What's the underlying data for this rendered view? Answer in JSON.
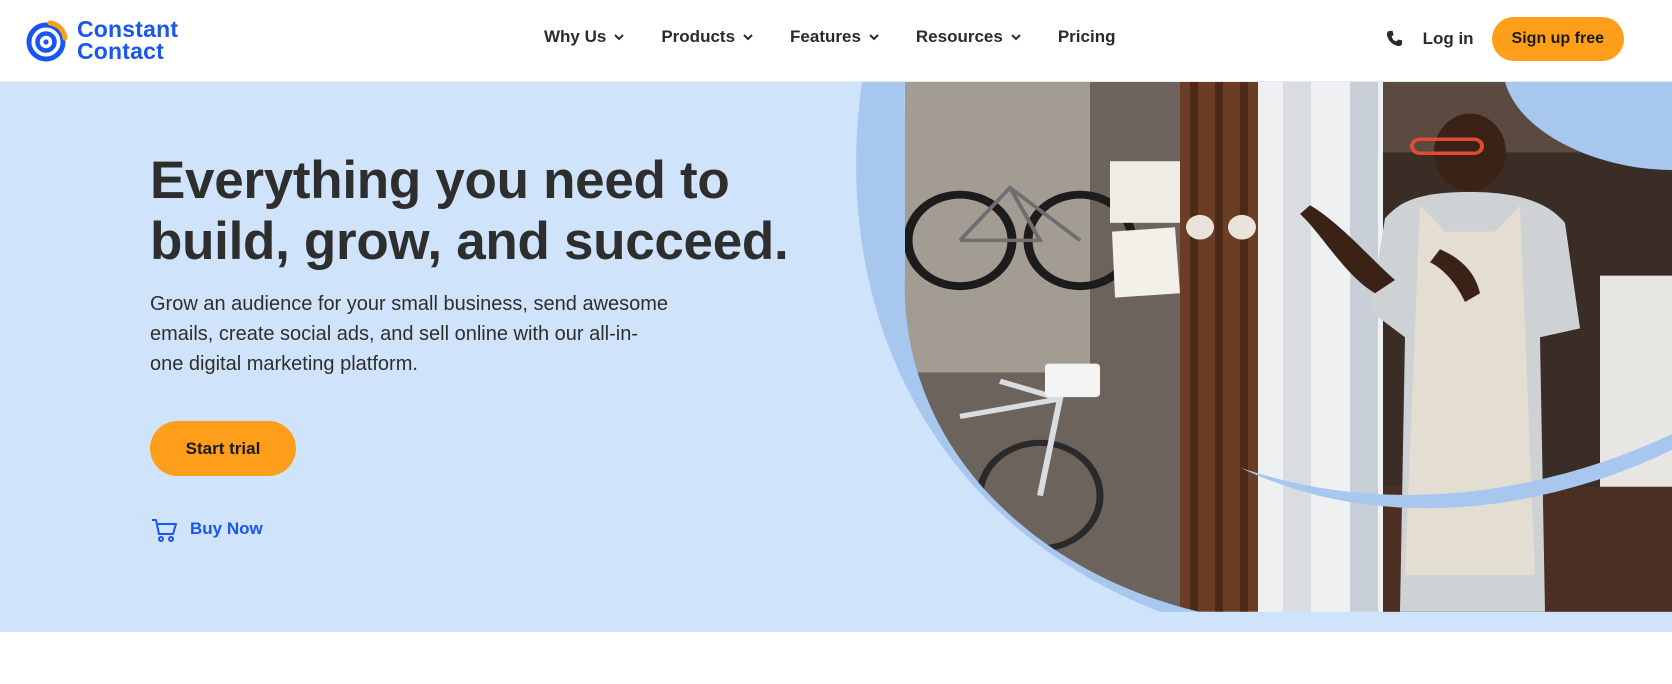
{
  "brand": {
    "line1": "Constant",
    "line2": "Contact",
    "color": "#1856ed",
    "accent": "#ff9e1b"
  },
  "nav": {
    "items": [
      {
        "label": "Why Us",
        "has_dropdown": true
      },
      {
        "label": "Products",
        "has_dropdown": true
      },
      {
        "label": "Features",
        "has_dropdown": true
      },
      {
        "label": "Resources",
        "has_dropdown": true
      },
      {
        "label": "Pricing",
        "has_dropdown": false
      }
    ],
    "phone_icon": "phone-icon",
    "login_label": "Log in",
    "signup_label": "Sign up free"
  },
  "hero": {
    "title_line1": "Everything you need to",
    "title_line2": "build, grow, and succeed.",
    "subtitle": "Grow an audience for your small business, send awesome emails, create social ads, and sell online with our all-in-one digital marketing platform.",
    "cta_label": "Start trial",
    "buy_label": "Buy Now",
    "buy_icon": "cart-icon",
    "background": "#cfe3fa"
  }
}
